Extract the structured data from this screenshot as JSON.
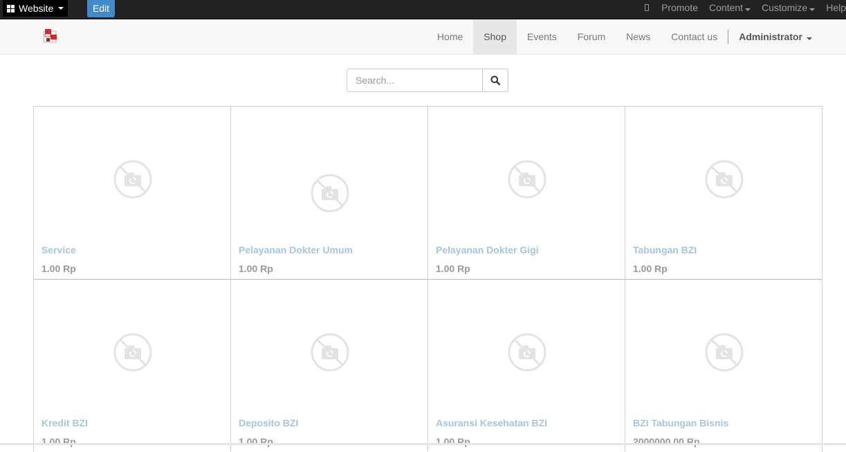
{
  "adminbar": {
    "website_label": "Website",
    "edit_label": "Edit",
    "right_items": [
      "Promote",
      "Content",
      "Customize",
      "Help"
    ]
  },
  "navbar": {
    "items": [
      "Home",
      "Shop",
      "Events",
      "Forum",
      "News",
      "Contact us"
    ],
    "active": "Shop",
    "user": "Administrator"
  },
  "search": {
    "placeholder": "Search..."
  },
  "products": [
    {
      "name": "Service",
      "price": "1.00 Rp"
    },
    {
      "name": "Pelayanan Dokter Umum",
      "price": "1.00 Rp"
    },
    {
      "name": "Pelayanan Dokter Gigi",
      "price": "1.00 Rp"
    },
    {
      "name": "Tabungan BZI",
      "price": "1.00 Rp"
    },
    {
      "name": "Kredit BZI",
      "price": "1.00 Rp"
    },
    {
      "name": "Deposito BZI",
      "price": "1.00 Rp"
    },
    {
      "name": "Asuransi Kesehatan BZI",
      "price": "1.00 Rp"
    },
    {
      "name": "BZI Tabungan Bisnis",
      "price": "2000000.00 Rp"
    }
  ],
  "colors": {
    "accent": "#428bca",
    "product_link": "#a3c6e6",
    "price": "#999999"
  }
}
